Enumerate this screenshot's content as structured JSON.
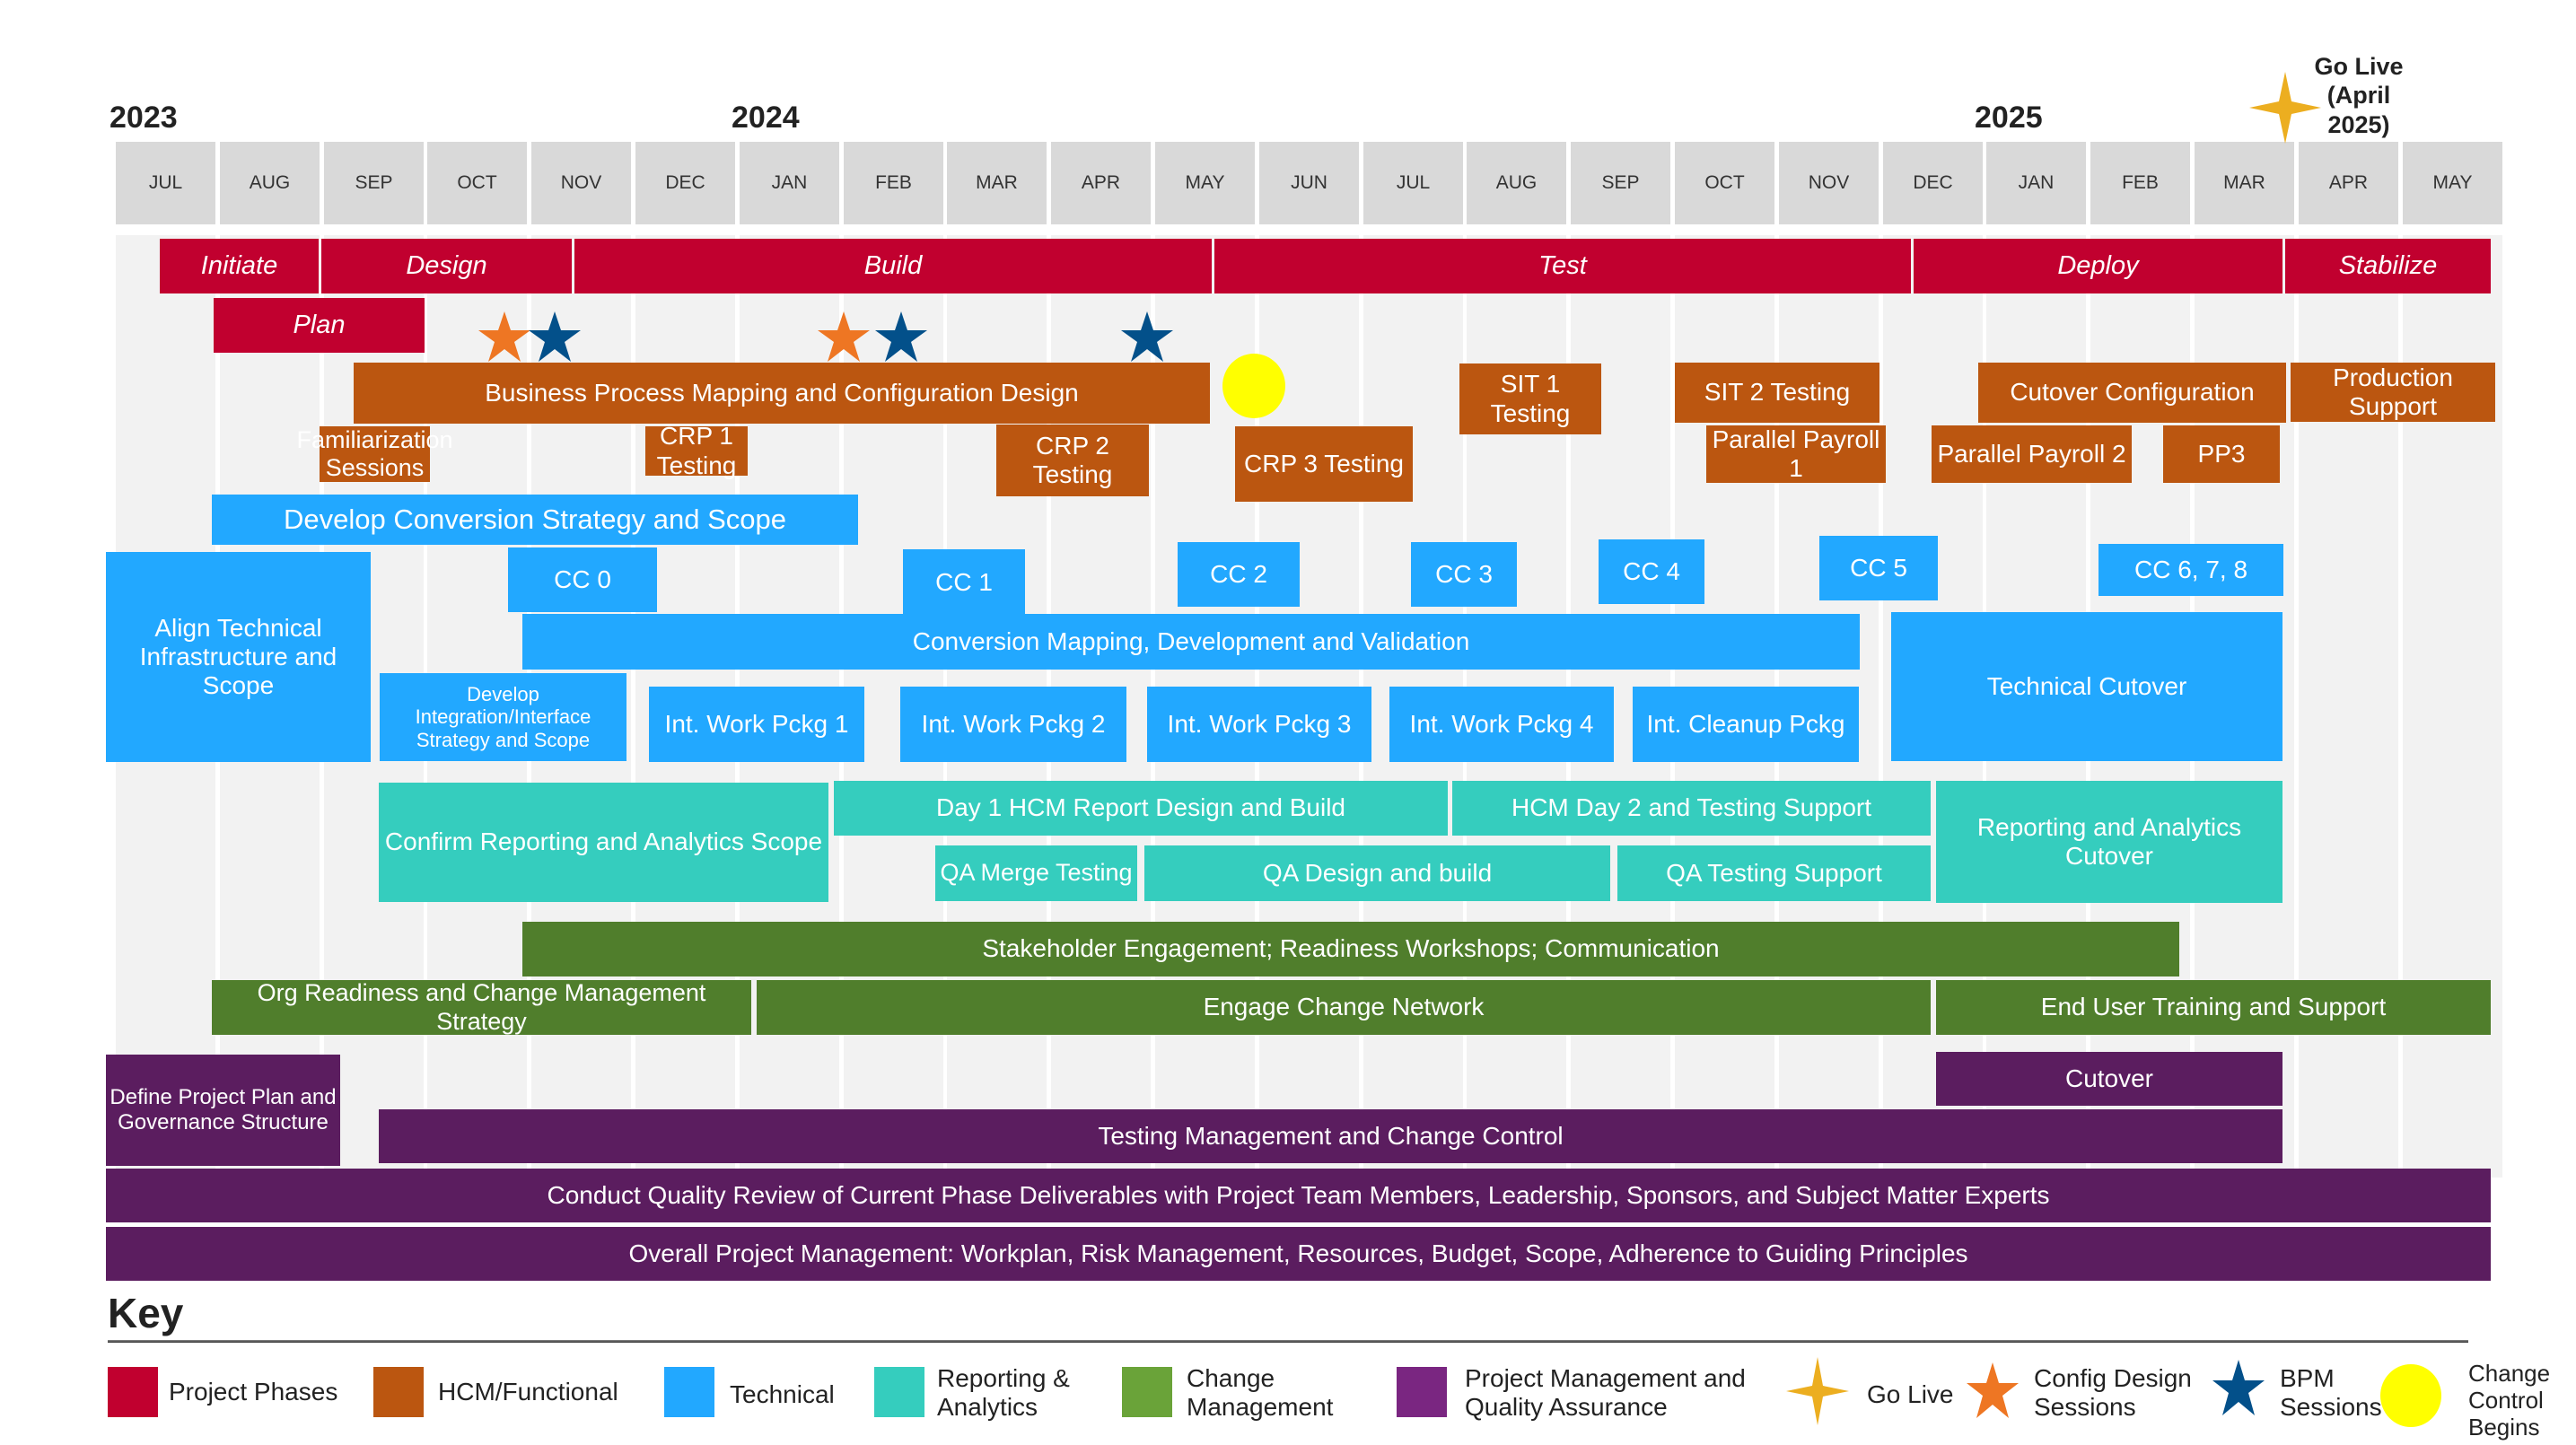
{
  "years": [
    {
      "label": "2023",
      "month_index": 0
    },
    {
      "label": "2024",
      "month_index": 6
    },
    {
      "label": "2025",
      "month_index": 18
    }
  ],
  "months": [
    "JUL",
    "AUG",
    "SEP",
    "OCT",
    "NOV",
    "DEC",
    "JAN",
    "FEB",
    "MAR",
    "APR",
    "MAY",
    "JUN",
    "JUL",
    "AUG",
    "SEP",
    "OCT",
    "NOV",
    "DEC",
    "JAN",
    "FEB",
    "MAR",
    "APR",
    "MAY"
  ],
  "go_live_label": "Go Live (April 2025)",
  "phases": [
    "Initiate",
    "Plan",
    "Design",
    "Build",
    "Test",
    "Deploy",
    "Stabilize"
  ],
  "hcm": {
    "bpm": "Business Process Mapping and Configuration Design",
    "familiarization": "Familiarization Sessions",
    "crp1": "CRP 1 Testing",
    "crp2": "CRP 2 Testing",
    "crp3": "CRP 3 Testing",
    "sit1": "SIT 1 Testing",
    "sit2": "SIT 2 Testing",
    "pp1": "Parallel Payroll 1",
    "cutover_config": "Cutover Configuration",
    "pp2": "Parallel Payroll 2",
    "pp3": "PP3",
    "prod_support": "Production Support"
  },
  "technical": {
    "conversion_strategy": "Develop Conversion Strategy and Scope",
    "align": "Align Technical Infrastructure and Scope",
    "cc": [
      "CC 0",
      "CC 1",
      "CC 2",
      "CC 3",
      "CC 4",
      "CC 5",
      "CC 6, 7, 8"
    ],
    "conversion_mapping": "Conversion Mapping, Development and Validation",
    "technical_cutover": "Technical Cutover",
    "integration_strategy": "Develop Integration/Interface Strategy and Scope",
    "work_pkgs": [
      "Int. Work Pckg 1",
      "Int. Work Pckg 2",
      "Int. Work Pckg 3",
      "Int. Work Pckg 4",
      "Int. Cleanup Pckg"
    ]
  },
  "reporting": {
    "confirm": "Confirm Reporting and Analytics Scope",
    "day1": "Day 1 HCM Report Design and Build",
    "day2": "HCM Day 2 and Testing Support",
    "cutover": "Reporting and Analytics Cutover",
    "qa_merge": "QA Merge Testing",
    "qa_design": "QA Design and build",
    "qa_testing": "QA Testing Support"
  },
  "change": {
    "stakeholder": "Stakeholder Engagement; Readiness Workshops; Communication",
    "org_readiness": "Org Readiness and Change Management Strategy",
    "engage": "Engage Change Network",
    "training": "End User Training and Support"
  },
  "pm": {
    "define": "Define Project Plan and Governance Structure",
    "cutover": "Cutover",
    "testing_mgmt": "Testing Management and Change Control",
    "quality_review": "Conduct Quality Review of Current Phase Deliverables with Project Team Members, Leadership, Sponsors, and Subject Matter Experts",
    "overall": "Overall Project Management: Workplan, Risk Management, Resources, Budget, Scope, Adherence to Guiding Principles"
  },
  "key": {
    "title": "Key",
    "items": [
      {
        "label": "Project Phases",
        "color": "#c1002f"
      },
      {
        "label": "HCM/Functional",
        "color": "#bb5610"
      },
      {
        "label": "Technical",
        "color": "#22a8ff"
      },
      {
        "label": "Reporting & Analytics",
        "color": "#35cdbe"
      },
      {
        "label": "Change Management",
        "color": "#6aa339"
      },
      {
        "label": "Project Management and Quality Assurance",
        "color": "#7a2681"
      }
    ],
    "symbols": [
      {
        "label": "Go Live",
        "icon": "four-point-star",
        "color": "#ecae20"
      },
      {
        "label": "Config Design Sessions",
        "icon": "orange-star",
        "color": "#ee7623"
      },
      {
        "label": "BPM Sessions",
        "icon": "blue-star",
        "color": "#03508a"
      },
      {
        "label": "Change Control Begins",
        "icon": "yellow-circle",
        "color": "#ffff00"
      }
    ]
  }
}
